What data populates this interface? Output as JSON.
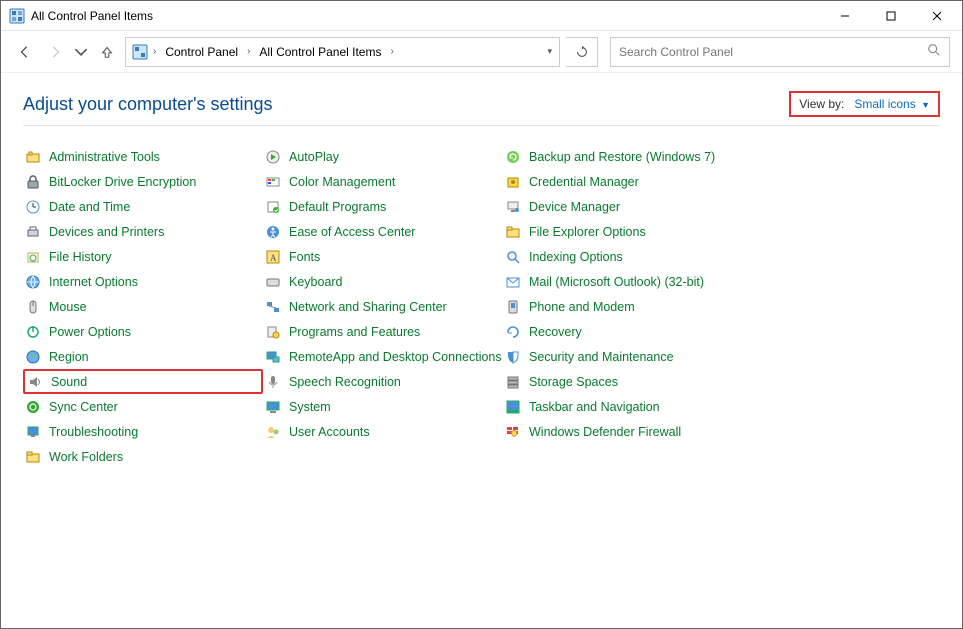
{
  "window": {
    "title": "All Control Panel Items"
  },
  "breadcrumbs": {
    "root": "Control Panel",
    "current": "All Control Panel Items"
  },
  "search": {
    "placeholder": "Search Control Panel"
  },
  "heading": "Adjust your computer's settings",
  "viewby": {
    "label": "View by:",
    "value": "Small icons"
  },
  "items": {
    "col1": [
      "Administrative Tools",
      "BitLocker Drive Encryption",
      "Date and Time",
      "Devices and Printers",
      "File History",
      "Internet Options",
      "Mouse",
      "Power Options",
      "Region",
      "Sound",
      "Sync Center",
      "Troubleshooting",
      "Work Folders"
    ],
    "col2": [
      "AutoPlay",
      "Color Management",
      "Default Programs",
      "Ease of Access Center",
      "Fonts",
      "Keyboard",
      "Network and Sharing Center",
      "Programs and Features",
      "RemoteApp and Desktop Connections",
      "Speech Recognition",
      "System",
      "User Accounts"
    ],
    "col3": [
      "Backup and Restore (Windows 7)",
      "Credential Manager",
      "Device Manager",
      "File Explorer Options",
      "Indexing Options",
      "Mail (Microsoft Outlook) (32-bit)",
      "Phone and Modem",
      "Recovery",
      "Security and Maintenance",
      "Storage Spaces",
      "Taskbar and Navigation",
      "Windows Defender Firewall"
    ]
  },
  "highlighted_item": "Sound"
}
